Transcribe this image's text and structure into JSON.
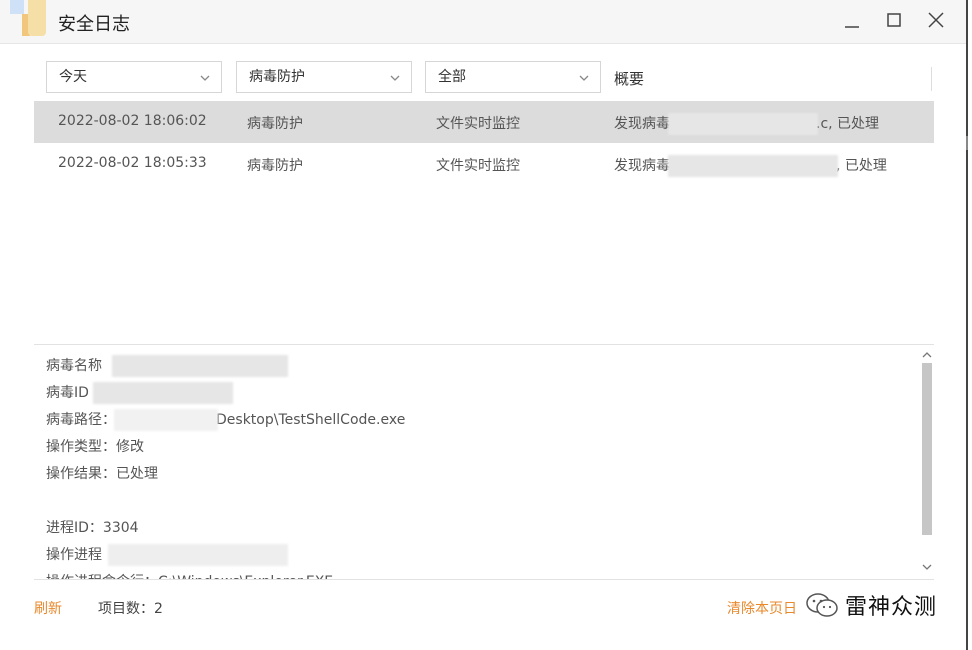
{
  "window": {
    "title": "安全日志"
  },
  "filters": {
    "date": "今天",
    "module": "病毒防护",
    "type": "全部",
    "summary_header": "概要"
  },
  "rows": [
    {
      "time": "2022-08-02 18:06:02",
      "module": "病毒防护",
      "source": "文件实时监控",
      "summary_prefix": "发现病毒",
      "summary_suffix": ".c, 已处理"
    },
    {
      "time": "2022-08-02 18:05:33",
      "module": "病毒防护",
      "source": "文件实时监控",
      "summary_prefix": "发现病毒",
      "summary_suffix": ", 已处理"
    }
  ],
  "detail": {
    "virus_name_label": "病毒名称",
    "virus_id_label": "病毒ID",
    "virus_path_label": "病毒路径：",
    "virus_path_tail": "Desktop\\TestShellCode.exe",
    "op_type": "操作类型：修改",
    "op_result": "操作结果：已处理",
    "process_id": "进程ID：3304",
    "op_process_label": "操作进程",
    "cmdline_partial": "操作进程命令行：C:\\Windows\\Explorer.EXE"
  },
  "footer": {
    "refresh": "刷新",
    "item_count": "项目数：2",
    "clear": "清除本页日",
    "watermark": "雷神众测"
  },
  "colors": {
    "accent": "#e8892c",
    "selected_row": "#dcdcdc"
  }
}
